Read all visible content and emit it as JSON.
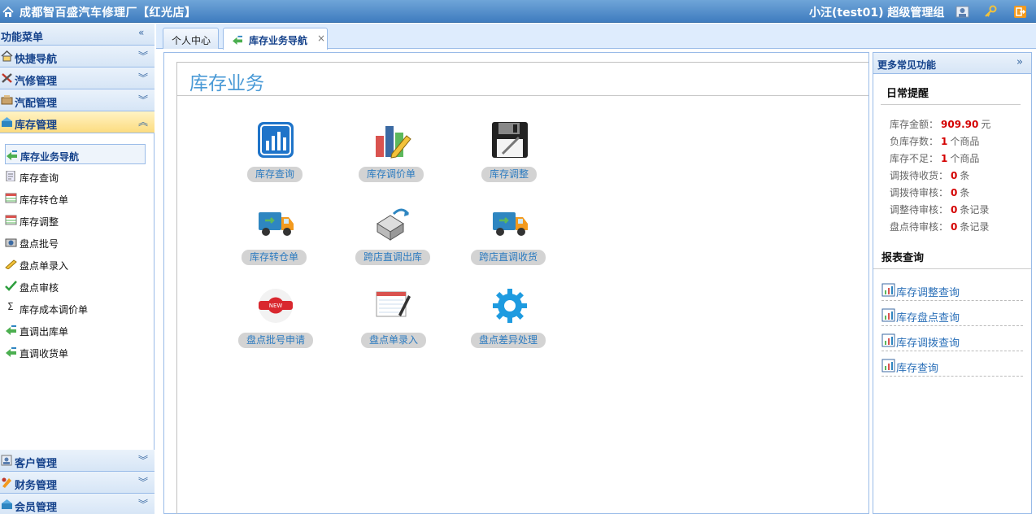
{
  "app": {
    "title": "成都智百盛汽车修理厂【红光店】",
    "user": "小汪(test01) 超级管理组"
  },
  "sidebar": {
    "header": "功能菜单",
    "collapse": "«",
    "groups": [
      {
        "label": "快捷导航"
      },
      {
        "label": "汽修管理"
      },
      {
        "label": "汽配管理"
      },
      {
        "label": "库存管理"
      }
    ],
    "items": [
      {
        "label": "库存业务导航"
      },
      {
        "label": "库存查询"
      },
      {
        "label": "库存转仓单"
      },
      {
        "label": "库存调整"
      },
      {
        "label": "盘点批号"
      },
      {
        "label": "盘点单录入"
      },
      {
        "label": "盘点审核"
      },
      {
        "label": "库存成本调价单"
      },
      {
        "label": "直调出库单"
      },
      {
        "label": "直调收货单"
      }
    ],
    "bottom_groups": [
      {
        "label": "客户管理"
      },
      {
        "label": "财务管理"
      },
      {
        "label": "会员管理"
      }
    ]
  },
  "tabs": [
    {
      "label": "个人中心"
    },
    {
      "label": "库存业务导航",
      "close": "×"
    }
  ],
  "main": {
    "heading": "库存业务",
    "functions": [
      {
        "label": "库存查询"
      },
      {
        "label": "库存调价单"
      },
      {
        "label": "库存调整"
      },
      {
        "label": "库存转仓单"
      },
      {
        "label": "跨店直调出库"
      },
      {
        "label": "跨店直调收货"
      },
      {
        "label": "盘点批号申请"
      },
      {
        "label": "盘点单录入"
      },
      {
        "label": "盘点差异处理"
      }
    ]
  },
  "right": {
    "header": "更多常见功能",
    "expand": "»",
    "reminder_title": "日常提醒",
    "stats": [
      {
        "label": "库存金额：",
        "value": "909.90",
        "unit": "元"
      },
      {
        "label": "负库存数：",
        "value": "1",
        "unit": "个商品"
      },
      {
        "label": "库存不足：",
        "value": "1",
        "unit": "个商品"
      },
      {
        "label": "调拨待收货：",
        "value": "0",
        "unit": "条"
      },
      {
        "label": "调拨待审核：",
        "value": "0",
        "unit": "条"
      },
      {
        "label": "调整待审核：",
        "value": "0",
        "unit": "条记录"
      },
      {
        "label": "盘点待审核：",
        "value": "0",
        "unit": "条记录"
      }
    ],
    "report_title": "报表查询",
    "reports": [
      {
        "label": "库存调整查询"
      },
      {
        "label": "库存盘点查询"
      },
      {
        "label": "库存调拨查询"
      },
      {
        "label": "库存查询"
      }
    ]
  }
}
